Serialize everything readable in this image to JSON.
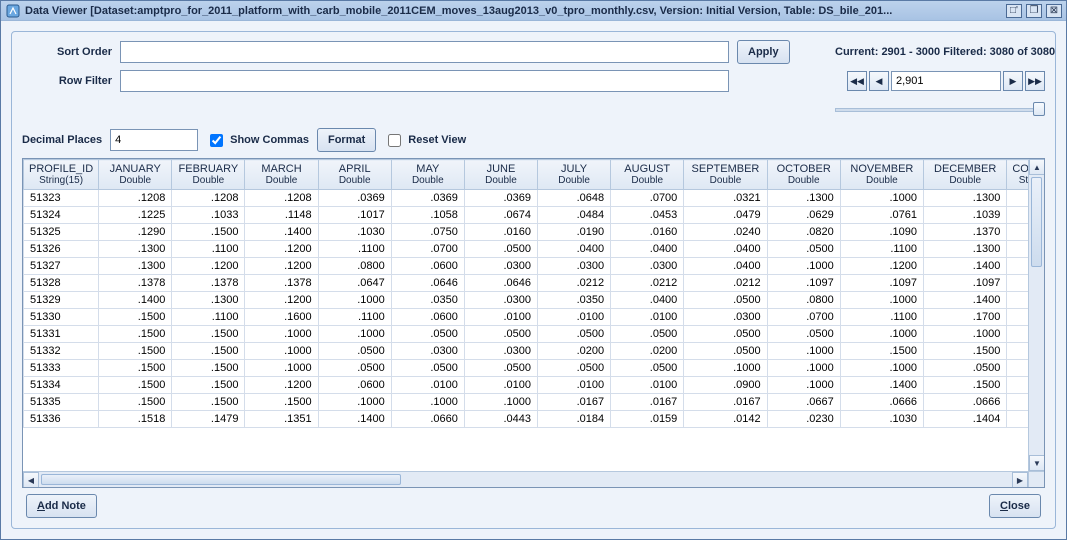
{
  "window": {
    "title": "Data Viewer [Dataset:amptpro_for_2011_platform_with_carb_mobile_2011CEM_moves_13aug2013_v0_tpro_monthly.csv, Version: Initial Version, Table: DS_bile_201..."
  },
  "labels": {
    "sort_order": "Sort Order",
    "row_filter": "Row Filter",
    "decimal_places": "Decimal Places",
    "show_commas": "Show Commas",
    "reset_view": "Reset View"
  },
  "buttons": {
    "apply": "Apply",
    "format": "Format",
    "add_note_u": "A",
    "add_note_rest": "dd Note",
    "close_u": "C",
    "close_rest": "lose"
  },
  "fields": {
    "sort_order": "",
    "row_filter": "",
    "decimal_places": "4",
    "show_commas": true,
    "reset_view": false
  },
  "status": {
    "text": "Current: 2901 - 3000 Filtered: 3080 of 3080"
  },
  "pager": {
    "value": "2,901"
  },
  "columns": [
    {
      "top": "PROFILE_ID",
      "sub": "String(15)"
    },
    {
      "top": "JANUARY",
      "sub": "Double"
    },
    {
      "top": "FEBRUARY",
      "sub": "Double"
    },
    {
      "top": "MARCH",
      "sub": "Double"
    },
    {
      "top": "APRIL",
      "sub": "Double"
    },
    {
      "top": "MAY",
      "sub": "Double"
    },
    {
      "top": "JUNE",
      "sub": "Double"
    },
    {
      "top": "JULY",
      "sub": "Double"
    },
    {
      "top": "AUGUST",
      "sub": "Double"
    },
    {
      "top": "SEPTEMBER",
      "sub": "Double"
    },
    {
      "top": "OCTOBER",
      "sub": "Double"
    },
    {
      "top": "NOVEMBER",
      "sub": "Double"
    },
    {
      "top": "DECEMBER",
      "sub": "Double"
    },
    {
      "top": "COM",
      "sub": "Str"
    }
  ],
  "rows": [
    {
      "id": "51323",
      "v": [
        ".1208",
        ".1208",
        ".1208",
        ".0369",
        ".0369",
        ".0369",
        ".0648",
        ".0700",
        ".0321",
        ".1300",
        ".1000",
        ".1300"
      ]
    },
    {
      "id": "51324",
      "v": [
        ".1225",
        ".1033",
        ".1148",
        ".1017",
        ".1058",
        ".0674",
        ".0484",
        ".0453",
        ".0479",
        ".0629",
        ".0761",
        ".1039"
      ]
    },
    {
      "id": "51325",
      "v": [
        ".1290",
        ".1500",
        ".1400",
        ".1030",
        ".0750",
        ".0160",
        ".0190",
        ".0160",
        ".0240",
        ".0820",
        ".1090",
        ".1370"
      ]
    },
    {
      "id": "51326",
      "v": [
        ".1300",
        ".1100",
        ".1200",
        ".1100",
        ".0700",
        ".0500",
        ".0400",
        ".0400",
        ".0400",
        ".0500",
        ".1100",
        ".1300"
      ]
    },
    {
      "id": "51327",
      "v": [
        ".1300",
        ".1200",
        ".1200",
        ".0800",
        ".0600",
        ".0300",
        ".0300",
        ".0300",
        ".0400",
        ".1000",
        ".1200",
        ".1400"
      ]
    },
    {
      "id": "51328",
      "v": [
        ".1378",
        ".1378",
        ".1378",
        ".0647",
        ".0646",
        ".0646",
        ".0212",
        ".0212",
        ".0212",
        ".1097",
        ".1097",
        ".1097"
      ]
    },
    {
      "id": "51329",
      "v": [
        ".1400",
        ".1300",
        ".1200",
        ".1000",
        ".0350",
        ".0300",
        ".0350",
        ".0400",
        ".0500",
        ".0800",
        ".1000",
        ".1400"
      ]
    },
    {
      "id": "51330",
      "v": [
        ".1500",
        ".1100",
        ".1600",
        ".1100",
        ".0600",
        ".0100",
        ".0100",
        ".0100",
        ".0300",
        ".0700",
        ".1100",
        ".1700"
      ]
    },
    {
      "id": "51331",
      "v": [
        ".1500",
        ".1500",
        ".1000",
        ".1000",
        ".0500",
        ".0500",
        ".0500",
        ".0500",
        ".0500",
        ".0500",
        ".1000",
        ".1000"
      ]
    },
    {
      "id": "51332",
      "v": [
        ".1500",
        ".1500",
        ".1000",
        ".0500",
        ".0300",
        ".0300",
        ".0200",
        ".0200",
        ".0500",
        ".1000",
        ".1500",
        ".1500"
      ]
    },
    {
      "id": "51333",
      "v": [
        ".1500",
        ".1500",
        ".1000",
        ".0500",
        ".0500",
        ".0500",
        ".0500",
        ".0500",
        ".1000",
        ".1000",
        ".1000",
        ".0500"
      ]
    },
    {
      "id": "51334",
      "v": [
        ".1500",
        ".1500",
        ".1200",
        ".0600",
        ".0100",
        ".0100",
        ".0100",
        ".0100",
        ".0900",
        ".1000",
        ".1400",
        ".1500"
      ]
    },
    {
      "id": "51335",
      "v": [
        ".1500",
        ".1500",
        ".1500",
        ".1000",
        ".1000",
        ".1000",
        ".0167",
        ".0167",
        ".0167",
        ".0667",
        ".0666",
        ".0666"
      ]
    },
    {
      "id": "51336",
      "v": [
        ".1518",
        ".1479",
        ".1351",
        ".1400",
        ".0660",
        ".0443",
        ".0184",
        ".0159",
        ".0142",
        ".0230",
        ".1030",
        ".1404"
      ]
    }
  ]
}
